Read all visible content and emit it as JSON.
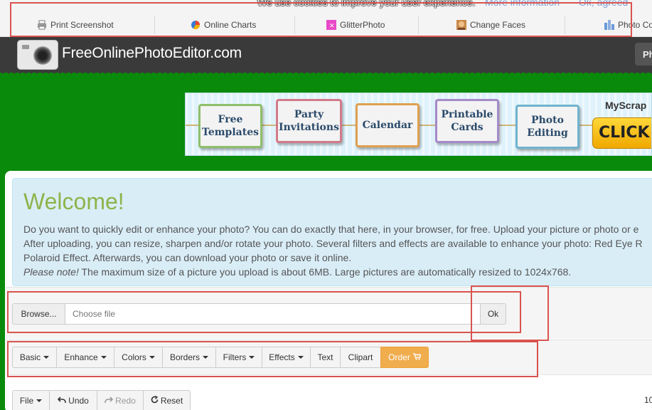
{
  "cookie": {
    "message": "We use cookies to improve your user experience.",
    "more_link": "More information",
    "agree_link": "Ok, agreed"
  },
  "toplinks": [
    {
      "label": "Print Screenshot",
      "icon": "printer-icon"
    },
    {
      "label": "Online Charts",
      "icon": "pie-chart-icon"
    },
    {
      "label": "GlitterPhoto",
      "icon": "glitter-icon"
    },
    {
      "label": "Change Faces",
      "icon": "face-icon"
    },
    {
      "label": "Photo Co",
      "icon": "photo-collage-icon"
    }
  ],
  "header": {
    "site_title": "FreeOnlinePhotoEditor.com",
    "nav_button": "Ph"
  },
  "banner": {
    "tiles": [
      {
        "label": "Free Templates",
        "color": "#8fbf6a"
      },
      {
        "label": "Party Invitations",
        "color": "#d27a8a"
      },
      {
        "label": "Calendar",
        "color": "#e0a050"
      },
      {
        "label": "Printable Cards",
        "color": "#a58ac8"
      },
      {
        "label": "Photo Editing",
        "color": "#6fb3cf"
      }
    ],
    "myscrap": "MyScrap",
    "cta": "CLICK H"
  },
  "welcome": {
    "title": "Welcome!",
    "line1": "Do you want to quickly edit or enhance your photo? You can do exactly that here, in your browser, for free. Upload your picture or photo or e",
    "line2": "After uploading, you can resize, sharpen and/or rotate your photo. Several filters and effects are available to enhance your photo: Red Eye R",
    "line3": "Polaroid Effect. Afterwards, you can download your photo or save it online.",
    "note_label": "Please note!",
    "note_text": " The maximum size of a picture you upload is about 6MB. Large pictures are automatically resized to 1024x768."
  },
  "upload": {
    "browse_label": "Browse...",
    "file_placeholder": "Choose file",
    "ok_label": "Ok"
  },
  "tools": {
    "basic": "Basic",
    "enhance": "Enhance",
    "colors": "Colors",
    "borders": "Borders",
    "filters": "Filters",
    "effects": "Effects",
    "text": "Text",
    "clipart": "Clipart",
    "order": "Order"
  },
  "bottom": {
    "file": "File",
    "undo": "Undo",
    "redo": "Redo",
    "reset": "Reset",
    "zoom": "10"
  },
  "colors": {
    "page_bg": "#0a8a0a",
    "header_bg": "#3a3a3a",
    "accent_green": "#8db44a",
    "order_orange": "#f0ad4e",
    "annotation_red": "#d9534f"
  }
}
